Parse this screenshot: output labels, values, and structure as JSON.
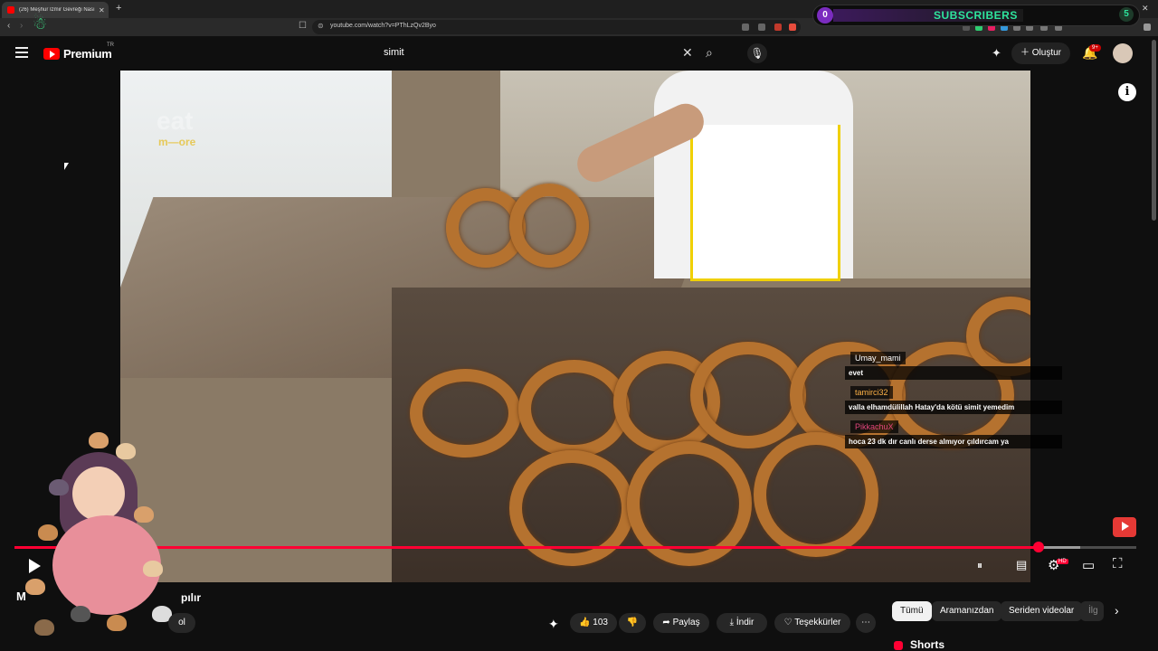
{
  "browser": {
    "tab_title": "(26) Meşhur İzmir Gevreği Nasıl",
    "tab_close": "✕",
    "new_tab": "+",
    "url": "youtube.com/watch?v=PThLzQv2Byo",
    "win_min": "–",
    "win_close": "✕"
  },
  "subscribers_widget": {
    "count": "0",
    "label": "SUBSCRIBERS",
    "goal": "5"
  },
  "youtube": {
    "logo_text": "Premium",
    "country": "TR",
    "search_value": "simit",
    "create_label": "Oluştur",
    "notification_count": "9+"
  },
  "video": {
    "watermark_line1": "eat",
    "watermark_line2": "m—ore",
    "progress_fraction": 0.913,
    "buffered_fraction": 0.95,
    "hd_badge": "HD"
  },
  "chat": [
    {
      "user": "Umay_mami",
      "text": "evet"
    },
    {
      "user": "tamirci32",
      "text": "valla elhamdülillah Hatay'da kötü simit yemedim"
    },
    {
      "user": "PikkachuX",
      "text": "hoca 23 dk dır canlı derse almıyor çıldırcam ya"
    }
  ],
  "below": {
    "title_start": "M",
    "title_end": "pılır",
    "sub_fragment": "ol",
    "like_count": "103",
    "share": "Paylaş",
    "download": "İndir",
    "thanks": "Teşekkürler",
    "more": "⋯",
    "chips": [
      "Tümü",
      "Aramanızdan",
      "Seriden videolar",
      "İlg"
    ],
    "shorts": "Shorts"
  },
  "colors": {
    "accent": "#ff0033",
    "subscribers_label": "#2ee59d",
    "background": "#0f0f0f"
  }
}
